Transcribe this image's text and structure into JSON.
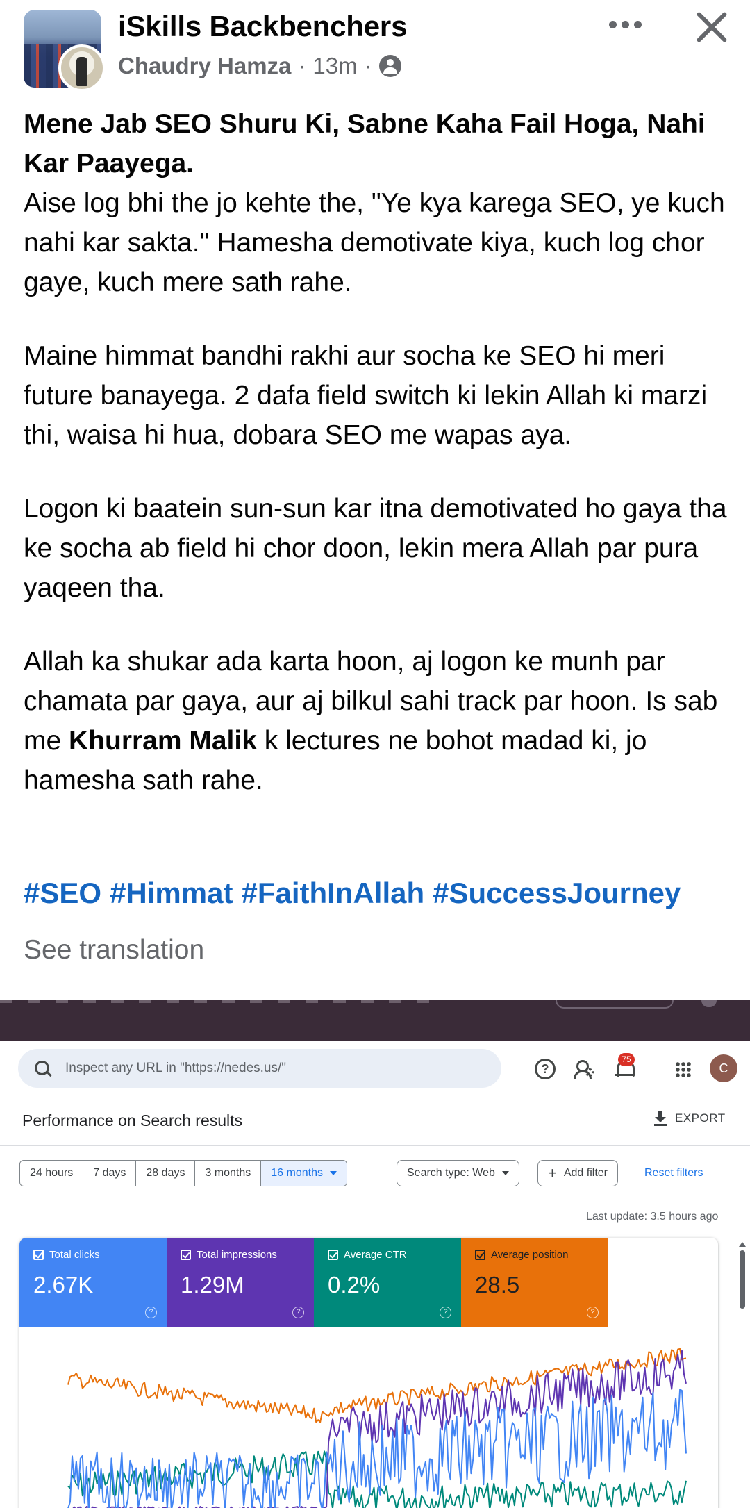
{
  "post": {
    "group_name": "iSkills Backbenchers",
    "author": "Chaudry Hamza",
    "time": "13m",
    "separator": "·",
    "headline": "Mene Jab SEO Shuru Ki, Sabne Kaha Fail Hoga, Nahi Kar Paayega.",
    "paragraph1": "Aise log bhi the jo kehte the, \"Ye kya karega SEO, ye kuch nahi kar sakta.\" Hamesha demotivate kiya, kuch log chor gaye, kuch mere sath rahe.",
    "paragraph2": "Maine himmat bandhi rakhi aur socha ke SEO hi meri future banayega. 2 dafa field switch ki lekin Allah ki marzi thi, waisa hi hua, dobara SEO me wapas aya.",
    "paragraph3": "Logon ki baatein sun-sun kar itna demotivated ho gaya tha ke socha ab field hi chor doon, lekin mera Allah par pura yaqeen tha.",
    "paragraph4_before": "Allah ka shukar ada karta hoon, aj logon ke munh par chamata par gaya, aur aj bilkul sahi track par hoon. Is sab me ",
    "paragraph4_bold": "Khurram Malik",
    "paragraph4_after": " k lectures ne bohot madad ki, jo hamesha sath rahe.",
    "hashtags": [
      "#SEO",
      "#Himmat",
      "#FaithInAllah",
      "#SuccessJourney"
    ],
    "see_translation": "See translation",
    "icons": {
      "privacy": "globe-icon",
      "more": "more-dots-icon",
      "close": "close-icon"
    }
  },
  "screenshot": {
    "search_placeholder": "Inspect any URL in \"https://nedes.us/\"",
    "help_glyph": "?",
    "notification_count": "75",
    "account_initial": "C",
    "heading": "Performance on Search results",
    "export_label": "EXPORT",
    "ranges": [
      "24 hours",
      "7 days",
      "28 days",
      "3 months",
      "16 months"
    ],
    "active_range": "16 months",
    "search_type_label": "Search type: Web",
    "add_filter_label": "Add filter",
    "add_filter_glyph": "+",
    "reset_filters_label": "Reset filters",
    "last_update": "Last update: 3.5 hours ago",
    "metrics": [
      {
        "label": "Total clicks",
        "value": "2.67K",
        "color": "#4285f4"
      },
      {
        "label": "Total impressions",
        "value": "1.29M",
        "color": "#5e35b1"
      },
      {
        "label": "Average CTR",
        "value": "0.2%",
        "color": "#00897b"
      },
      {
        "label": "Average position",
        "value": "28.5",
        "color": "#e8710a"
      }
    ],
    "metric_help_glyph": "?"
  },
  "colors": {
    "hashtag": "#1565c0",
    "clicks": "#4285f4",
    "impressions": "#5e35b1",
    "ctr": "#00897b",
    "position": "#e8710a",
    "topbar": "#3a2b38"
  }
}
